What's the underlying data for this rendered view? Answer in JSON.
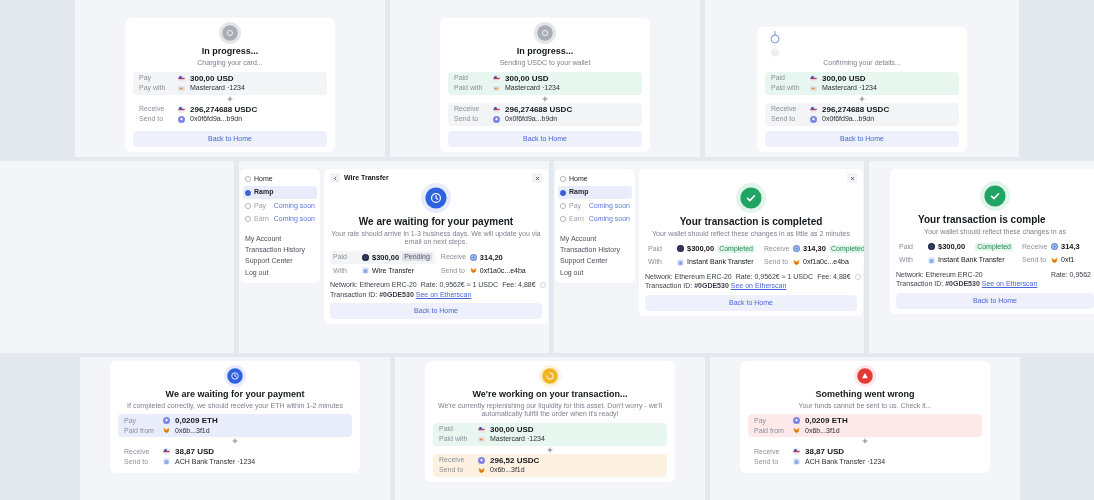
{
  "rows": [
    {
      "tiles": [
        {
          "kind": "mobile",
          "status_icon": {
            "kind": "progress"
          },
          "title": "In progress...",
          "subtitle": "Charging your card...",
          "pay": {
            "label": "Pay",
            "asset_icon": {
              "kind": "usd"
            },
            "amount": "300,00 USD",
            "sub_label": "Pay with",
            "method_icon": {
              "kind": "card"
            },
            "method_text": "Mastercard ·1234",
            "color": "#f3f4f6"
          },
          "receive": {
            "label": "Receive",
            "asset_icon": {
              "kind": "usd"
            },
            "amount": "296,274688 USDC",
            "sub_label": "Send to",
            "method_icon": {
              "kind": "eth"
            },
            "method_text": "0x0f6fd9a...b9dn",
            "color": "#ffffff"
          },
          "button": "Back to Home"
        },
        {
          "kind": "mobile",
          "status_icon": {
            "kind": "progress"
          },
          "title": "In progress...",
          "subtitle": "Sending USDC to your wallet",
          "pay": {
            "label": "Paid",
            "asset_icon": {
              "kind": "usd"
            },
            "amount": "300,00 USD",
            "sub_label": "Paid with",
            "method_icon": {
              "kind": "card"
            },
            "method_text": "Mastercard ·1234",
            "color": "#e7f6ee"
          },
          "receive": {
            "label": "Receive",
            "asset_icon": {
              "kind": "usd"
            },
            "amount": "296,274688 USDC",
            "sub_label": "Send to",
            "method_icon": {
              "kind": "eth"
            },
            "method_text": "0x0f6fd9a...b9dn",
            "color": "#f3f4f6"
          },
          "button": "Back to Home"
        },
        {
          "kind": "mobile",
          "status_icon": {
            "kind": "steps"
          },
          "subtitle": "Confirming your details...",
          "pay": {
            "label": "Paid",
            "asset_icon": {
              "kind": "usd"
            },
            "amount": "300,00 USD",
            "sub_label": "Paid with",
            "method_icon": {
              "kind": "card"
            },
            "method_text": "Mastercard ·1234",
            "color": "#e7f6ee"
          },
          "receive": {
            "label": "Receive",
            "asset_icon": {
              "kind": "usd"
            },
            "amount": "296,274688 USDC",
            "sub_label": "Send to",
            "method_icon": {
              "kind": "eth"
            },
            "method_text": "0x0f6fd9a...b9dn",
            "color": "#f3f4f6"
          },
          "button": "Back to Home"
        }
      ]
    },
    {
      "tiles": [
        {
          "kind": "empty"
        },
        {
          "kind": "desktop",
          "sidebar": {
            "items": [
              {
                "label": "Home",
                "selected": false,
                "disabled": false
              },
              {
                "label": "Ramp",
                "selected": true,
                "disabled": false
              },
              {
                "label": "Pay",
                "selected": false,
                "disabled": true,
                "note": "Coming soon"
              },
              {
                "label": "Earn",
                "selected": false,
                "disabled": true,
                "note": "Coming soon"
              }
            ],
            "links": [
              "My Account",
              "Transaction History",
              "Support Center",
              "Log out"
            ]
          },
          "header": "Wire Transfer",
          "status_icon": {
            "kind": "waiting"
          },
          "title": "We are waiting for your payment",
          "subtitle": "Your rate should arrive in 1-3 business days. We will update you via email on next steps.",
          "details": [
            {
              "label": "Paid",
              "icon": {
                "kind": "coin"
              },
              "value": "$300,00",
              "badge": {
                "kind": "pending",
                "text": "Pending"
              },
              "color": "#f3f4f6"
            },
            {
              "label": "Receive",
              "icon": {
                "kind": "usdc"
              },
              "value": "314,20",
              "color": "#ffffff"
            },
            {
              "label": "With",
              "icon": {
                "kind": "bank"
              },
              "value": "Wire Transfer",
              "color": "#ffffff"
            },
            {
              "label": "Send to",
              "icon": {
                "kind": "wallet"
              },
              "value": "0xf1a0c...e4ba",
              "color": "#ffffff"
            }
          ],
          "network": "Network: Ethereum ERC-20",
          "tx_label": "Transaction ID:",
          "tx_id": "#0GDE530",
          "link": "See on Etherscan",
          "rate": "Rate: 0,9562€ ≈ 1 USDC",
          "fee": "Fee: 4,88€",
          "button": "Back to Home"
        },
        {
          "kind": "desktop",
          "sidebar": {
            "items": [
              {
                "label": "Home",
                "selected": false,
                "disabled": false
              },
              {
                "label": "Ramp",
                "selected": true,
                "disabled": false
              },
              {
                "label": "Pay",
                "selected": false,
                "disabled": true,
                "note": "Coming soon"
              },
              {
                "label": "Earn",
                "selected": false,
                "disabled": true,
                "note": "Coming soon"
              }
            ],
            "links": [
              "My Account",
              "Transaction History",
              "Support Center",
              "Log out"
            ]
          },
          "status_icon": {
            "kind": "completed"
          },
          "title": "Your transaction is completed",
          "subtitle": "Your wallet should reflect these changes in as little as 2 minutes",
          "details": [
            {
              "label": "Paid",
              "icon": {
                "kind": "coin"
              },
              "value": "$300,00",
              "badge": {
                "kind": "completed",
                "text": "Completed"
              },
              "color": "#ffffff"
            },
            {
              "label": "Receive",
              "icon": {
                "kind": "usdc"
              },
              "value": "314,30",
              "badge": {
                "kind": "completed",
                "text": "Completed"
              },
              "color": "#ffffff"
            },
            {
              "label": "With",
              "icon": {
                "kind": "bank"
              },
              "value": "Instant Bank Transfer",
              "color": "#ffffff"
            },
            {
              "label": "Send to",
              "icon": {
                "kind": "wallet"
              },
              "value": "0xf1a0c...e4ba",
              "color": "#ffffff"
            }
          ],
          "network": "Network: Ethereum ERC-20",
          "tx_label": "Transaction ID:",
          "tx_id": "#0GDE530",
          "link": "See on Etherscan",
          "rate": "Rate: 0,9562€ ≈ 1 USDC",
          "fee": "Fee: 4,88€",
          "button": "Back to Home"
        },
        {
          "kind": "desktop_cut",
          "status_icon": {
            "kind": "completed"
          },
          "title": "Your transaction is comple",
          "subtitle": "Your wallet should reflect these changes in as",
          "details": [
            {
              "label": "Paid",
              "icon": {
                "kind": "coin"
              },
              "value": "$300,00",
              "badge": {
                "kind": "completed",
                "text": "Completed"
              },
              "color": "#ffffff"
            },
            {
              "label": "Receive",
              "icon": {
                "kind": "usdc"
              },
              "value": "314,3",
              "color": "#ffffff"
            },
            {
              "label": "With",
              "icon": {
                "kind": "bank"
              },
              "value": "Instant Bank Transfer",
              "color": "#ffffff"
            },
            {
              "label": "Send to",
              "icon": {
                "kind": "wallet"
              },
              "value": "0xf1",
              "color": "#ffffff"
            }
          ],
          "network": "Network: Ethereum ERC-20",
          "tx_label": "Transaction ID:",
          "tx_id": "#0GDE530",
          "link": "See on Etherscan",
          "rate": "Rate: 0,9562",
          "button": "Back to Home"
        }
      ]
    },
    {
      "tiles": [
        {
          "kind": "mobile",
          "status_icon": {
            "kind": "waiting"
          },
          "title": "We are waiting for your payment",
          "subtitle": "If completed correctly, we should receive your ETH within 1-2 minutes",
          "pay": {
            "label": "Pay",
            "asset_icon": {
              "kind": "eth"
            },
            "amount": "0,0209 ETH",
            "sub_label": "Paid from",
            "method_icon": {
              "kind": "wallet"
            },
            "method_text": "0x6b...3f1d",
            "color": "#e8ecfb"
          },
          "receive": {
            "label": "Receive",
            "asset_icon": {
              "kind": "usd"
            },
            "amount": "38,87 USD",
            "sub_label": "Send to",
            "method_icon": {
              "kind": "bank"
            },
            "method_text": "ACH Bank Transfer ·1234",
            "color": "#ffffff"
          }
        },
        {
          "kind": "mobile",
          "status_icon": {
            "kind": "working"
          },
          "title": "We're working on your transaction...",
          "subtitle": "We're currently replenishing our liquidity for this asset. Don't worry - we'll automatically fulfill the order when it's ready!",
          "pay": {
            "label": "Paid",
            "asset_icon": {
              "kind": "usd"
            },
            "amount": "300,00 USD",
            "sub_label": "Paid with",
            "method_icon": {
              "kind": "card"
            },
            "method_text": "Mastercard ·1234",
            "color": "#e7f6ee"
          },
          "receive": {
            "label": "Receive",
            "asset_icon": {
              "kind": "eth"
            },
            "amount": "296,52 USDC",
            "sub_label": "Send to",
            "method_icon": {
              "kind": "wallet"
            },
            "method_text": "0x6b...3f1d",
            "color": "#fdf2e1"
          }
        },
        {
          "kind": "mobile",
          "status_icon": {
            "kind": "error"
          },
          "title": "Something went wrong",
          "subtitle": "Your funds cannot be sent to us. Check it...",
          "pay": {
            "label": "Pay",
            "asset_icon": {
              "kind": "eth"
            },
            "amount": "0,0209 ETH",
            "sub_label": "Paid from",
            "method_icon": {
              "kind": "wallet"
            },
            "method_text": "0x6b...3f1d",
            "color": "#fde9e9"
          },
          "receive": {
            "label": "Receive",
            "asset_icon": {
              "kind": "usd"
            },
            "amount": "38,87 USD",
            "sub_label": "Send to",
            "method_icon": {
              "kind": "bank"
            },
            "method_text": "ACH Bank Transfer ·1234",
            "color": "#ffffff"
          }
        }
      ]
    }
  ]
}
